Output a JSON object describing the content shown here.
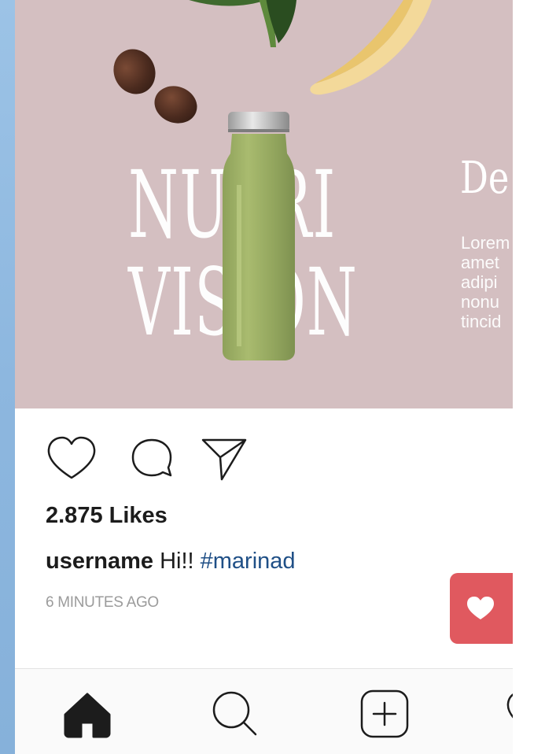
{
  "post": {
    "image": {
      "brand_line_1": "NUTRI",
      "brand_line_2": "VISION",
      "next_slide_heading": "De",
      "next_slide_text": [
        "Lorem",
        "amet",
        "adipi",
        "nonu",
        "tincid"
      ],
      "background_color": "#d4bfc1"
    },
    "likes_text": "2.875 Likes",
    "caption": {
      "username": "username",
      "text": "Hi!!",
      "hashtag": "#marinad"
    },
    "timestamp": "6 MINUTES AGO"
  },
  "actions": {
    "like_icon": "heart-outline-icon",
    "comment_icon": "comment-bubble-icon",
    "share_icon": "paper-plane-icon"
  },
  "floating_like": {
    "icon": "heart-filled-icon",
    "color": "#e0595f"
  },
  "bottom_nav": {
    "items": [
      {
        "name": "home",
        "icon": "home-filled-icon"
      },
      {
        "name": "search",
        "icon": "search-icon"
      },
      {
        "name": "add",
        "icon": "add-square-icon"
      },
      {
        "name": "activity",
        "icon": "heart-outline-icon"
      }
    ]
  },
  "colors": {
    "hashtag": "#1f4f86",
    "timestamp": "#9b9b9b",
    "left_edge": "#8db7df"
  }
}
